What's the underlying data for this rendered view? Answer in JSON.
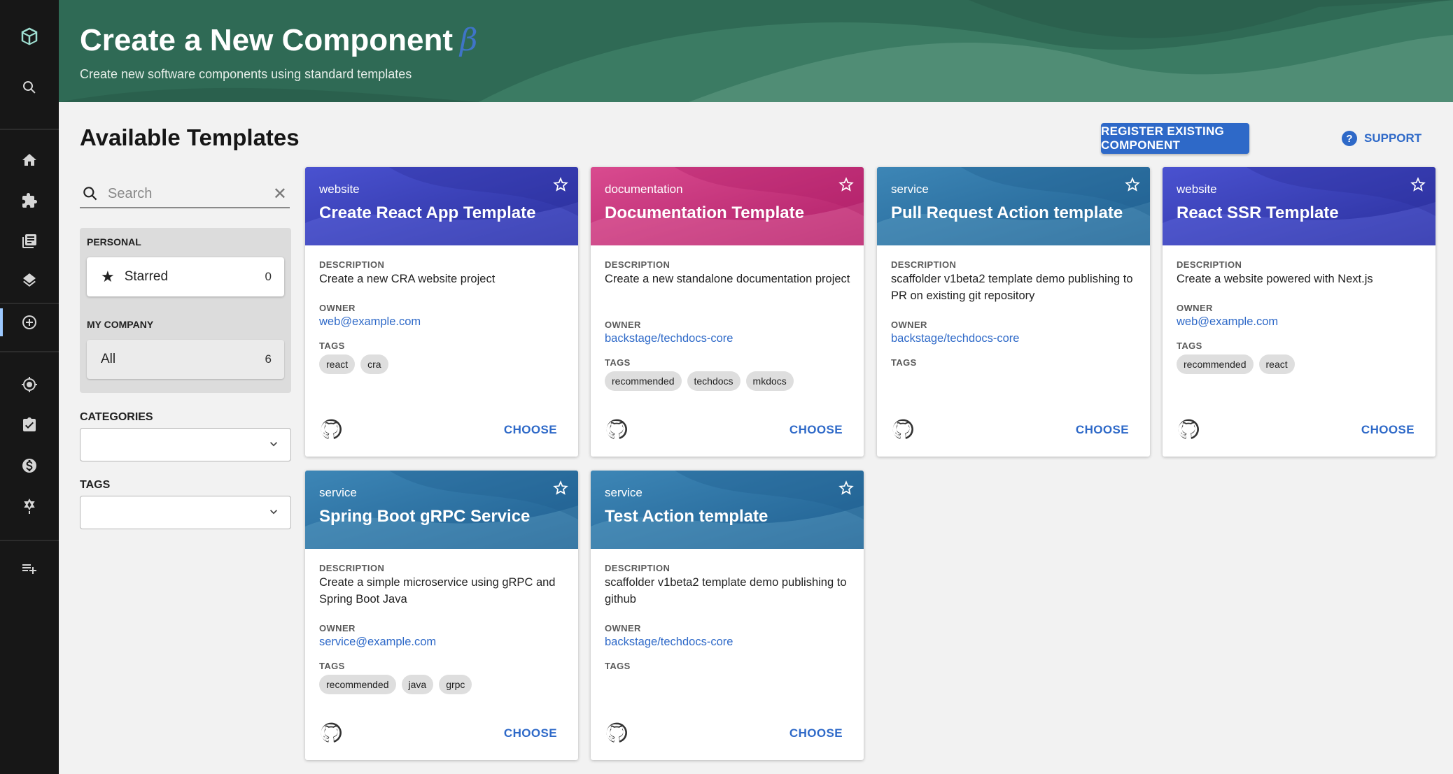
{
  "header": {
    "title": "Create a New Component",
    "beta": "β",
    "subtitle": "Create new software components using standard templates"
  },
  "page_title": "Available Templates",
  "actions": {
    "register": "REGISTER EXISTING COMPONENT",
    "support": "SUPPORT"
  },
  "search": {
    "placeholder": "Search"
  },
  "filters": {
    "personal_label": "PERSONAL",
    "starred_label": "Starred",
    "starred_count": "0",
    "company_label": "MY COMPANY",
    "all_label": "All",
    "all_count": "6",
    "categories_label": "CATEGORIES",
    "tags_label": "TAGS"
  },
  "card_labels": {
    "description": "DESCRIPTION",
    "owner": "OWNER",
    "tags": "TAGS",
    "choose": "CHOOSE"
  },
  "cards": [
    {
      "type": "website",
      "title": "Create React App Template",
      "description": "Create a new CRA website project",
      "owner": "web@example.com",
      "tags": [
        "react",
        "cra"
      ]
    },
    {
      "type": "documentation",
      "title": "Documentation Template",
      "description": "Create a new standalone documentation project",
      "owner": "backstage/techdocs-core",
      "tags": [
        "recommended",
        "techdocs",
        "mkdocs"
      ]
    },
    {
      "type": "service",
      "title": "Pull Request Action template",
      "description": "scaffolder v1beta2 template demo publishing to PR on existing git repository",
      "owner": "backstage/techdocs-core",
      "tags": []
    },
    {
      "type": "website",
      "title": "React SSR Template",
      "description": "Create a website powered with Next.js",
      "owner": "web@example.com",
      "tags": [
        "recommended",
        "react"
      ]
    },
    {
      "type": "service",
      "title": "Spring Boot gRPC Service",
      "description": "Create a simple microservice using gRPC and Spring Boot Java",
      "owner": "service@example.com",
      "tags": [
        "recommended",
        "java",
        "grpc"
      ]
    },
    {
      "type": "service",
      "title": "Test Action template",
      "description": "scaffolder v1beta2 template demo publishing to github",
      "owner": "backstage/techdocs-core",
      "tags": []
    }
  ],
  "sidebar_icons": [
    "logo-icon",
    "search-icon",
    "home-icon",
    "puzzle-icon",
    "docs-icon",
    "layers-icon",
    "create-icon",
    "radar-icon",
    "checklist-icon",
    "cost-icon",
    "graph-icon",
    "menu-add-icon"
  ],
  "colors": {
    "header": "#2f6a55",
    "accent": "#2e69c8",
    "website": "#3a3fb5",
    "documentation": "#c7337a",
    "service": "#2c6fa3"
  }
}
